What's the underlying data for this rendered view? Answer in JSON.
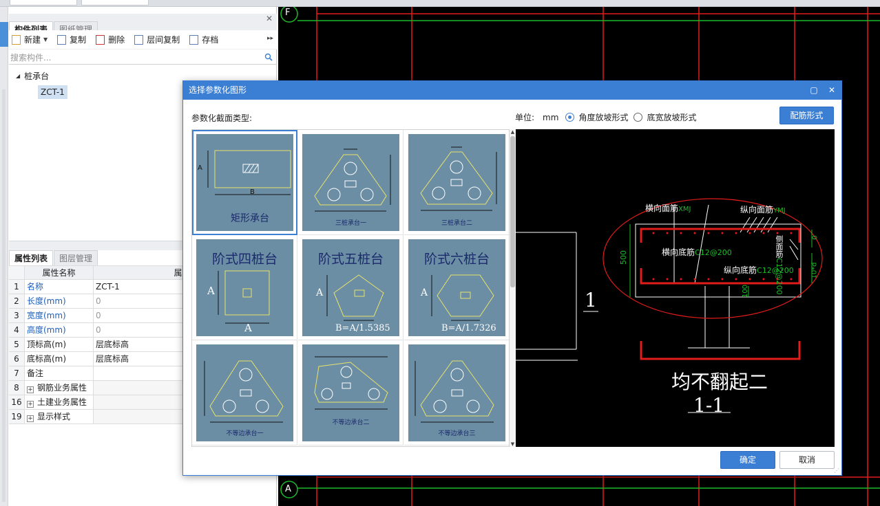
{
  "left_panel": {
    "tabs": [
      "构件列表",
      "图纸管理"
    ],
    "toolbar": {
      "new": "新建",
      "copy": "复制",
      "delete": "删除",
      "floor_copy": "层间复制",
      "archive": "存档"
    },
    "search_placeholder": "搜索构件...",
    "tree": {
      "root": "桩承台",
      "leaf": "ZCT-1"
    }
  },
  "properties": {
    "tabs": [
      "属性列表",
      "图层管理"
    ],
    "headers": {
      "name": "属性名称",
      "value": "属性值"
    },
    "rows": [
      {
        "num": "1",
        "name": "名称",
        "value": "ZCT-1"
      },
      {
        "num": "2",
        "name": "长度(mm)",
        "value": "0"
      },
      {
        "num": "3",
        "name": "宽度(mm)",
        "value": "0"
      },
      {
        "num": "4",
        "name": "高度(mm)",
        "value": "0"
      },
      {
        "num": "5",
        "name": "顶标高(m)",
        "value": "层底标高"
      },
      {
        "num": "6",
        "name": "底标高(m)",
        "value": "层底标高"
      },
      {
        "num": "7",
        "name": "备注",
        "value": ""
      },
      {
        "num": "8",
        "name": "钢筋业务属性",
        "value": ""
      },
      {
        "num": "16",
        "name": "土建业务属性",
        "value": ""
      },
      {
        "num": "19",
        "name": "显示样式",
        "value": ""
      }
    ]
  },
  "cad": {
    "axis_top": "F",
    "axis_bottom": "A",
    "section_number": "1"
  },
  "dialog": {
    "title": "选择参数化图形",
    "section_type_label": "参数化截面类型:",
    "unit_label": "单位:",
    "unit_value": "mm",
    "radio_angle": "角度放坡形式",
    "radio_width": "底宽放坡形式",
    "rebar_button": "配筋形式",
    "ok": "确定",
    "cancel": "取消",
    "tiles": [
      {
        "title": "",
        "caption": "矩形承台",
        "dim_a": "A",
        "dim_b": "B"
      },
      {
        "title": "",
        "caption": "三桩承台一",
        "dim_a": "",
        "dim_b": ""
      },
      {
        "title": "",
        "caption": "三桩承台二",
        "dim_a": "",
        "dim_b": ""
      },
      {
        "title": "阶式四桩台",
        "caption": "",
        "dim_a": "A",
        "dim_b": "A"
      },
      {
        "title": "阶式五桩台",
        "caption": "",
        "dim_a": "A",
        "dim_b": "B=A/1.5385"
      },
      {
        "title": "阶式六桩台",
        "caption": "",
        "dim_a": "A",
        "dim_b": "B=A/1.7326"
      },
      {
        "title": "",
        "caption": "不等边承台一",
        "dim_a": "",
        "dim_b": ""
      },
      {
        "title": "",
        "caption": "不等边承台二",
        "dim_a": "",
        "dim_b": ""
      },
      {
        "title": "",
        "caption": "不等边承台三",
        "dim_a": "",
        "dim_b": ""
      }
    ],
    "preview": {
      "top_transverse": "横向面筋",
      "top_transverse_code": "XMJ",
      "top_longitudinal": "纵向面筋",
      "top_longitudinal_code": "YMJ",
      "bottom_transverse": "横向底筋",
      "bottom_transverse_code": "C12@200",
      "bottom_longitudinal": "纵向底筋",
      "bottom_longitudinal_code": "C12@200",
      "side_label": "侧面筋",
      "side_code": "C12@200",
      "height": "500",
      "cover": "100",
      "right_dim_top": "0",
      "right_dim_bottom": "10*d",
      "note": "均不翻起二",
      "section": "1-1"
    }
  }
}
